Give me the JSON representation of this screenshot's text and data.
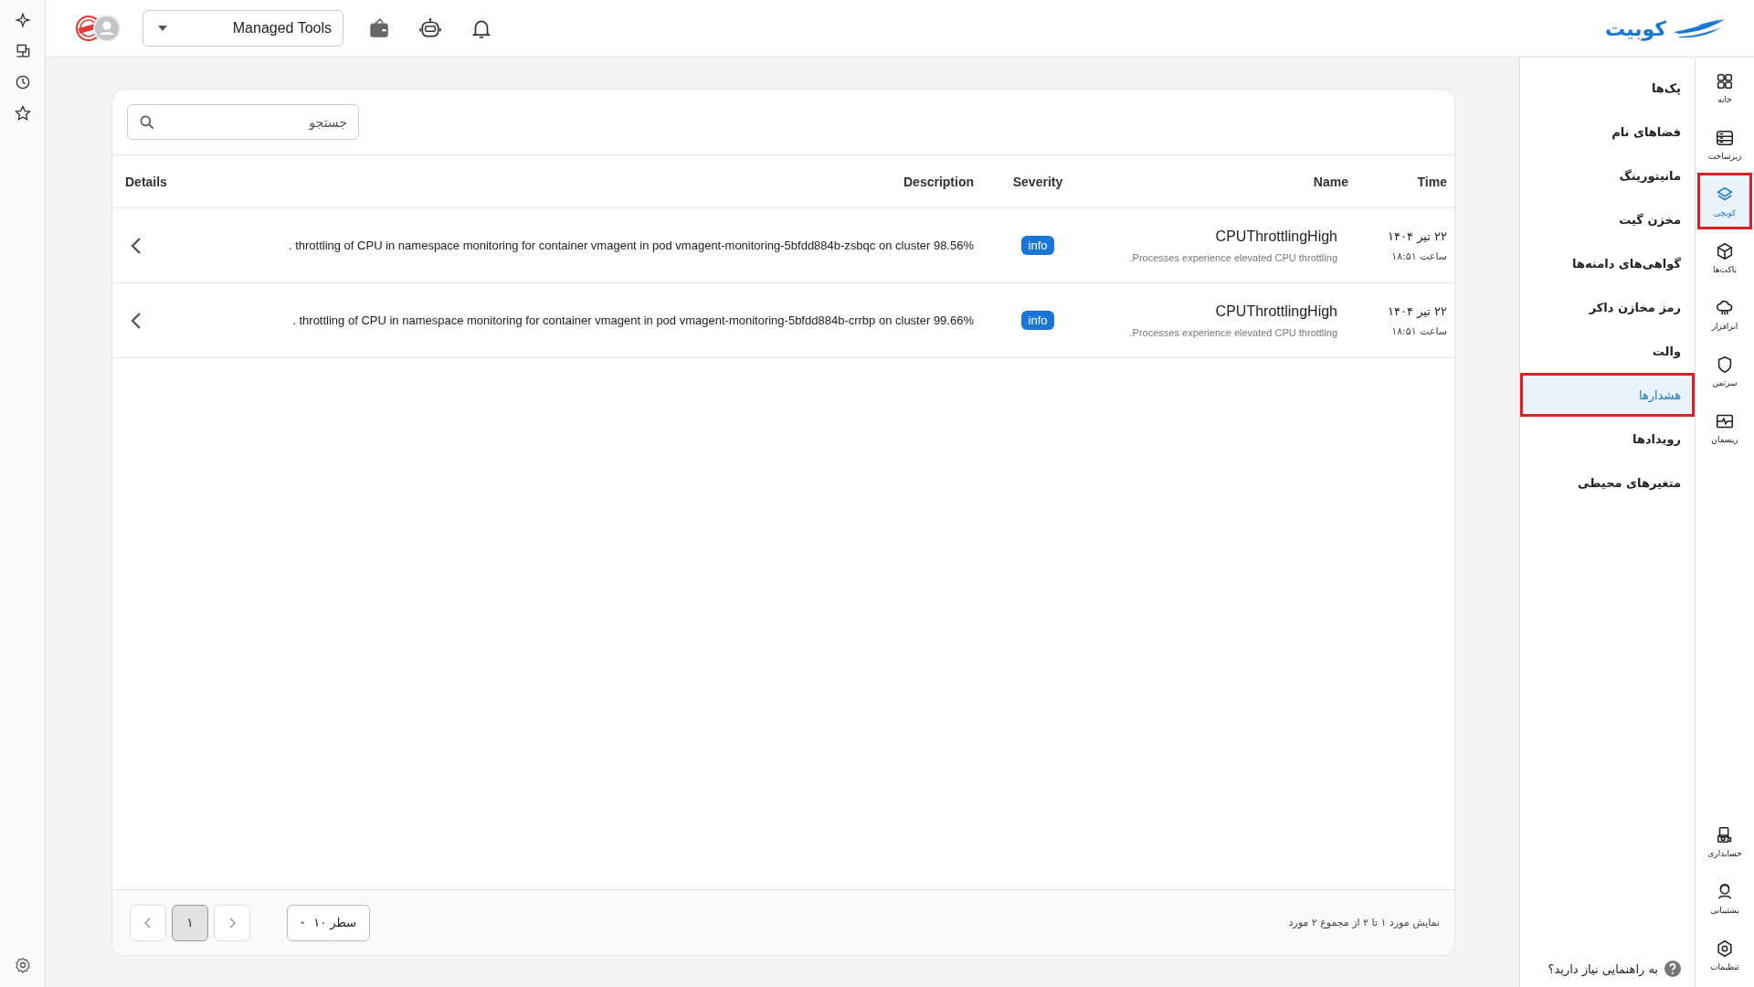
{
  "top_bar": {
    "project_select": {
      "value": "Managed Tools"
    },
    "logo": {
      "text": "کوبیت"
    }
  },
  "search": {
    "placeholder": "جستجو"
  },
  "table": {
    "columns": [
      "Time",
      "Name",
      "Severity",
      "Description",
      "Details"
    ],
    "rows": [
      {
        "date": "۲۲ تیر ۱۴۰۴",
        "clock": "ساعت ۱۸:۵۱",
        "name": "CPUThrottlingHigh",
        "summary": ".Processes experience elevated CPU throttling",
        "severity": "info",
        "description": ". throttling of CPU in namespace monitoring for container vmagent in pod vmagent-monitoring-5bfdd884b-zsbqc on cluster 98.56%"
      },
      {
        "date": "۲۲ تیر ۱۴۰۴",
        "clock": "ساعت ۱۸:۵۱",
        "name": "CPUThrottlingHigh",
        "summary": ".Processes experience elevated CPU throttling",
        "severity": "info",
        "description": ". throttling of CPU in namespace monitoring for container vmagent in pod vmagent-monitoring-5bfdd884b-crrbp on cluster 99.66%"
      }
    ]
  },
  "pagination": {
    "summary": "نمایش مورد ۱ تا ۲ از مجموع ۲ مورد",
    "rows_per_page": "۱۰ سطر",
    "pages": [
      {
        "label": "۱",
        "selected": true
      }
    ]
  },
  "menu": {
    "items": [
      {
        "label": "پک‌ها",
        "selected": false,
        "highlighted": false
      },
      {
        "label": "فضاهای نام",
        "selected": false,
        "highlighted": false
      },
      {
        "label": "مانیتورینگ",
        "selected": false,
        "highlighted": false
      },
      {
        "label": "مخزن گیت",
        "selected": false,
        "highlighted": false
      },
      {
        "label": "گواهی‌های دامنه‌ها",
        "selected": false,
        "highlighted": false
      },
      {
        "label": "رمز مخازن داکر",
        "selected": false,
        "highlighted": false
      },
      {
        "label": "والت",
        "selected": false,
        "highlighted": false
      },
      {
        "label": "هشدارها",
        "selected": true,
        "highlighted": true
      },
      {
        "label": "رویدادها",
        "selected": false,
        "highlighted": false
      },
      {
        "label": "متغیرهای محیطی",
        "selected": false,
        "highlighted": false
      }
    ]
  },
  "help_link": "به راهنمایی نیاز دارید؟",
  "nav_rail": {
    "items": [
      {
        "label": "خانه",
        "kind": "home",
        "selected": false,
        "highlighted": false
      },
      {
        "label": "زیرساخت",
        "kind": "server",
        "selected": false,
        "highlighted": false
      },
      {
        "label": "کوبچی",
        "kind": "layers",
        "selected": true,
        "highlighted": true
      },
      {
        "label": "باکت‌ها",
        "kind": "cube",
        "selected": false,
        "highlighted": false
      },
      {
        "label": "ابرافزار",
        "kind": "cloud",
        "selected": false,
        "highlighted": false
      },
      {
        "label": "سرتمن",
        "kind": "shield",
        "selected": false,
        "highlighted": false
      },
      {
        "label": "ریسمان",
        "kind": "pulse",
        "selected": false,
        "highlighted": false
      }
    ],
    "bottom_items": [
      {
        "label": "حسابداری",
        "kind": "accounting",
        "selected": false,
        "highlighted": false
      },
      {
        "label": "پشتیبانی",
        "kind": "support",
        "selected": false,
        "highlighted": false
      },
      {
        "label": "تنظیمات",
        "kind": "settings",
        "selected": false,
        "highlighted": false
      }
    ]
  }
}
